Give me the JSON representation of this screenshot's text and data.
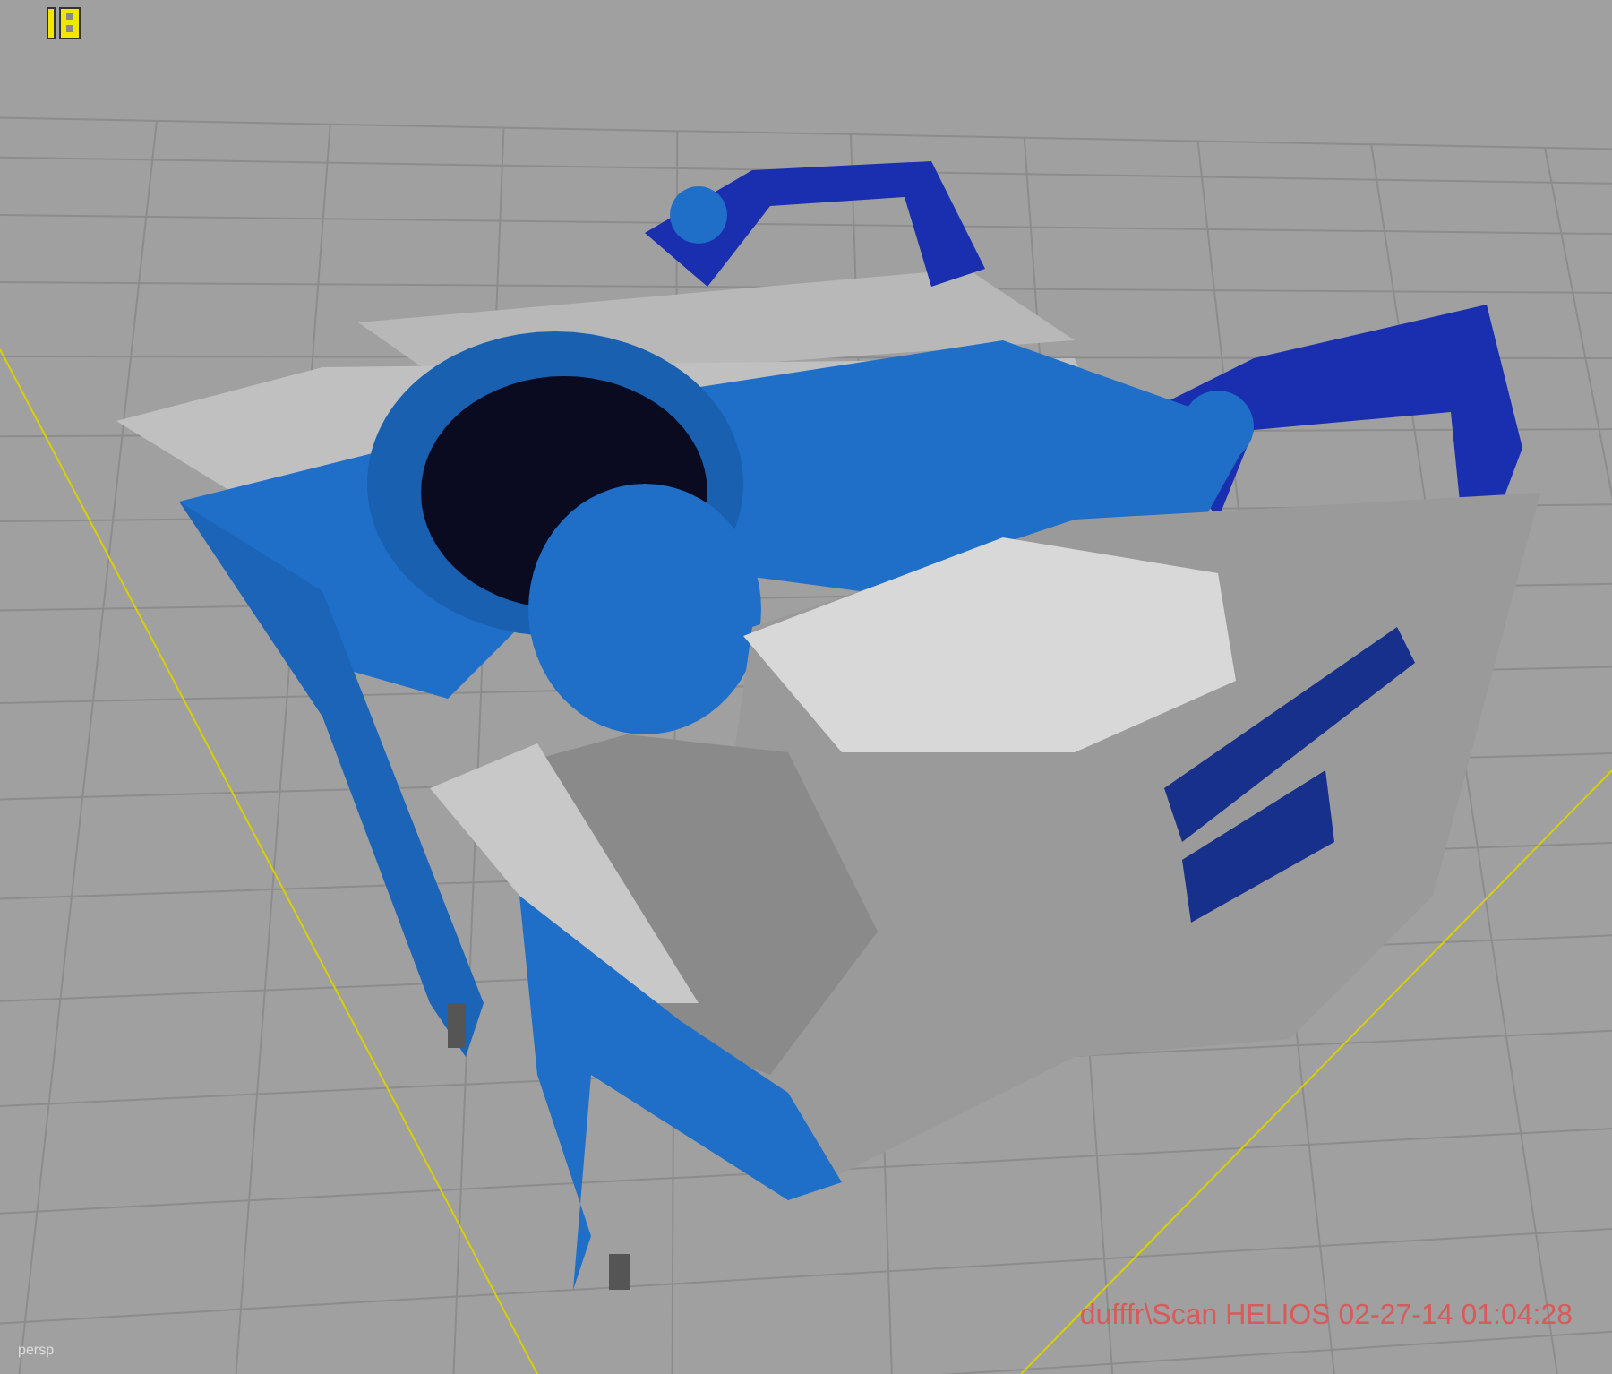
{
  "viewport": {
    "camera": "persp",
    "stamp": "dufffr\\Scan HELIOS 02-27-14 01:04:28"
  }
}
